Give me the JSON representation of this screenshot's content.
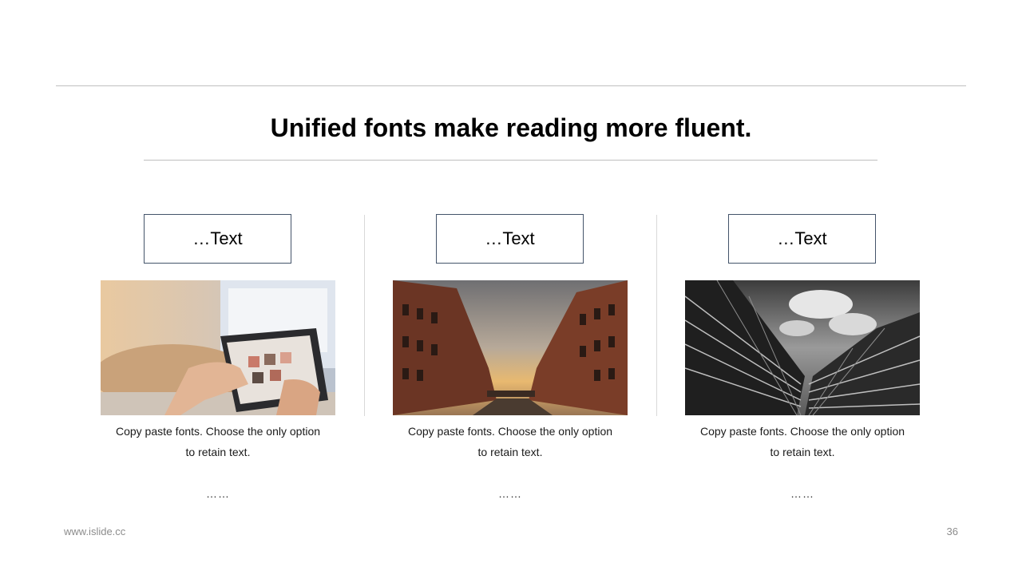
{
  "slide": {
    "title": "Unified fonts make reading more fluent."
  },
  "cards": [
    {
      "label": "…Text",
      "caption_line1": "Copy paste fonts. Choose the only option",
      "caption_line2": "to retain text.",
      "more": "……",
      "image_icon": "tablet-photo-icon"
    },
    {
      "label": "…Text",
      "caption_line1": "Copy paste fonts. Choose the only option",
      "caption_line2": "to retain text.",
      "more": "……",
      "image_icon": "canal-buildings-photo-icon"
    },
    {
      "label": "…Text",
      "caption_line1": "Copy paste fonts. Choose the only option",
      "caption_line2": "to retain text.",
      "more": "……",
      "image_icon": "skyscraper-photo-icon"
    }
  ],
  "footer": {
    "website": "www.islide.cc",
    "page_number": "36"
  },
  "colors": {
    "box_border": "#44546a",
    "rule": "#bfbfbf",
    "title": "#000000"
  }
}
